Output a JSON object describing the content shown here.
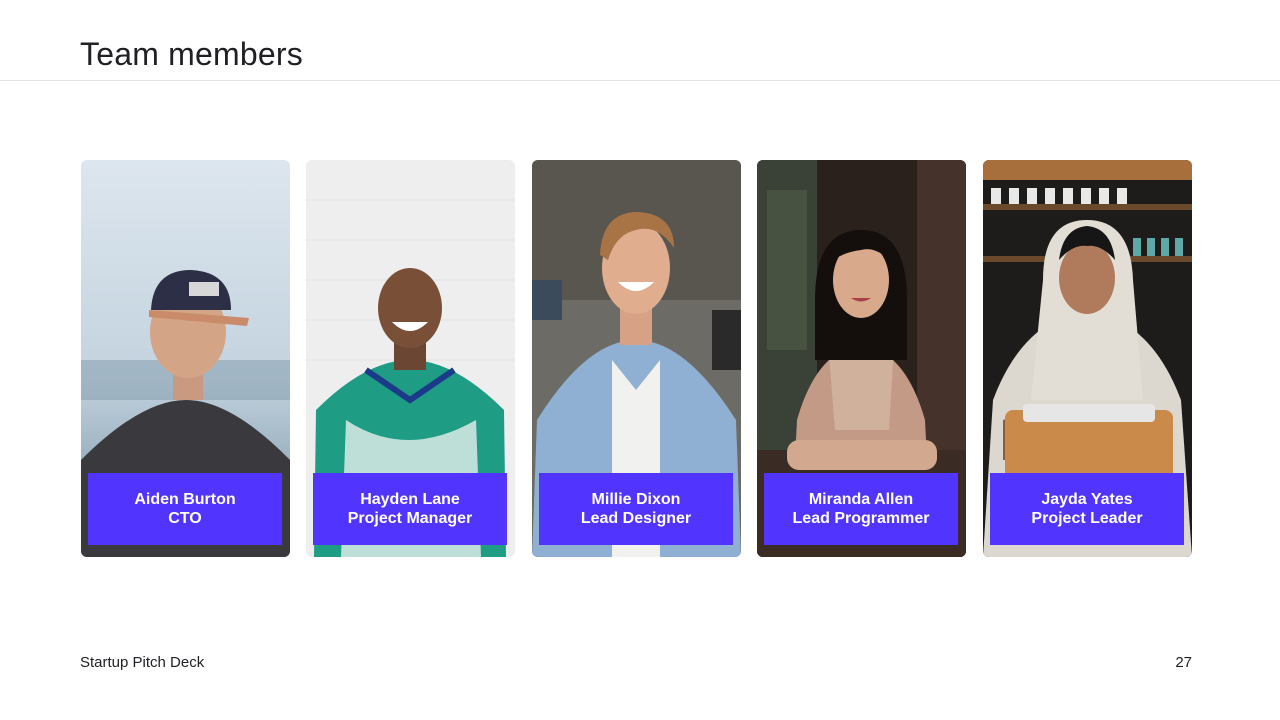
{
  "slide": {
    "title": "Team members",
    "footer_title": "Startup Pitch Deck",
    "page_number": "27"
  },
  "colors": {
    "accent": "#5135ff",
    "text": "#1f1f24",
    "divider": "#e2e2e6"
  },
  "team": [
    {
      "name": "Aiden Burton",
      "role": "CTO",
      "photo": "person-photo"
    },
    {
      "name": "Hayden Lane",
      "role": "Project Manager",
      "photo": "person-photo"
    },
    {
      "name": "Millie Dixon",
      "role": "Lead Designer",
      "photo": "person-photo"
    },
    {
      "name": "Miranda Allen",
      "role": "Lead Programmer",
      "photo": "person-photo"
    },
    {
      "name": "Jayda Yates",
      "role": "Project Leader",
      "photo": "person-photo"
    }
  ]
}
